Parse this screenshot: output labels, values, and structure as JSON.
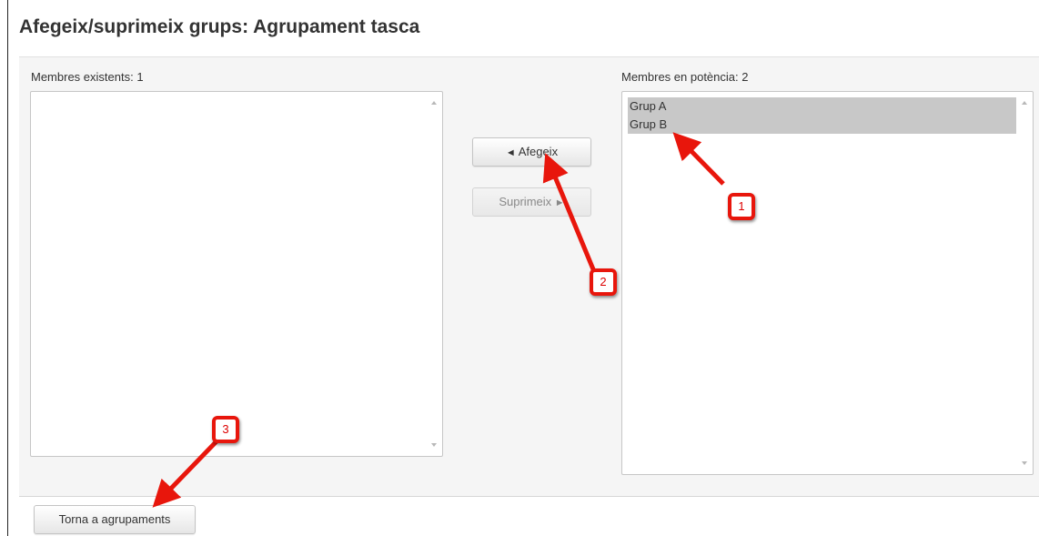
{
  "page": {
    "title": "Afegeix/suprimeix grups: Agrupament tasca"
  },
  "existing": {
    "label": "Membres existents: 1",
    "options": []
  },
  "potential": {
    "label": "Membres en potència: 2",
    "options": [
      "Grup A",
      "Grup B"
    ]
  },
  "actions": {
    "add_label": "Afegeix",
    "add_icon": "◄",
    "remove_label": "Suprimeix",
    "remove_icon": "►"
  },
  "footer": {
    "back_label": "Torna a agrupaments"
  },
  "annotations": {
    "badges": [
      "1",
      "2",
      "3"
    ],
    "color": "#e8160c"
  }
}
